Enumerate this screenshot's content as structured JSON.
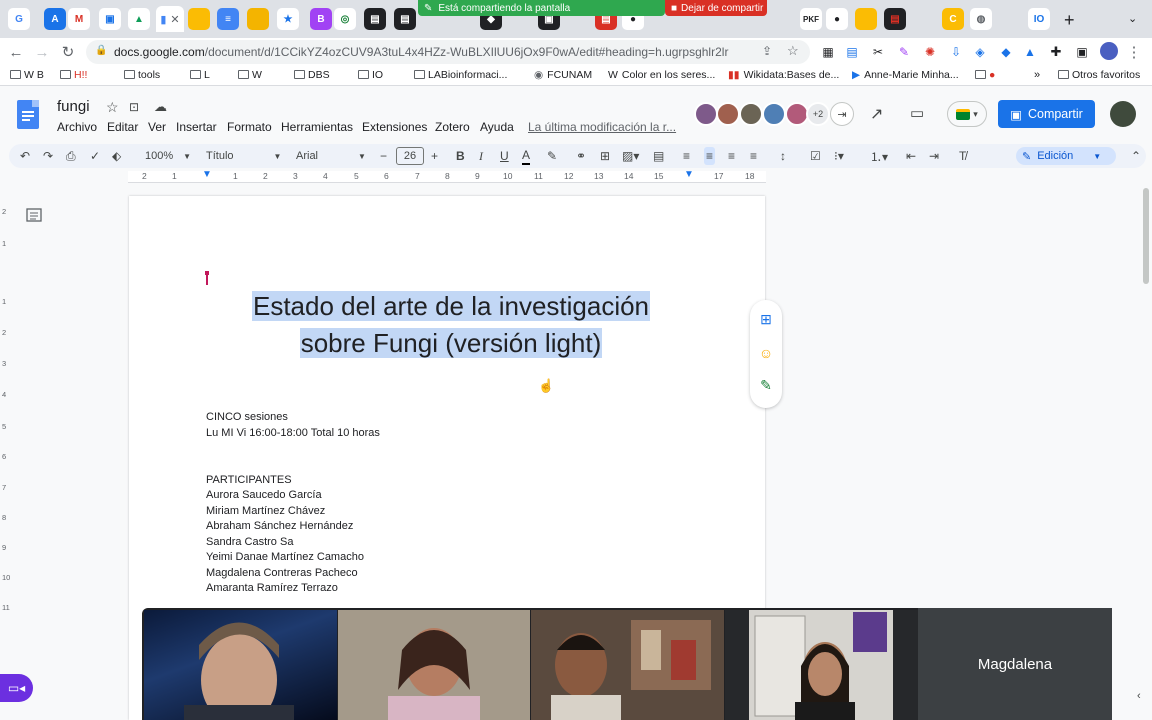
{
  "browser": {
    "sharing_banner": "Está compartiendo la pantalla",
    "stop_sharing": "Dejar de compartir",
    "url_domain": "docs.google.com",
    "url_path": "/document/d/1CCikYZ4ozCUV9A3tuL4x4HZz-WuBLXIlUU6jOx9F0wA/edit#heading=h.ugrpsghlr2lr",
    "new_tab": "+"
  },
  "bookmarks": [
    {
      "label": "W B"
    },
    {
      "label": "H!!"
    },
    {
      "label": "tools"
    },
    {
      "label": "L"
    },
    {
      "label": "W"
    },
    {
      "label": "DBS"
    },
    {
      "label": "IO"
    },
    {
      "label": "LABioinformaci..."
    },
    {
      "label": "FCUNAM"
    },
    {
      "label": "Color en los seres..."
    },
    {
      "label": "Wikidata:Bases de..."
    },
    {
      "label": "Anne-Marie Minha..."
    },
    {
      "label": "»"
    },
    {
      "label": "Otros favoritos"
    }
  ],
  "docs": {
    "title": "fungi",
    "menus": [
      "Archivo",
      "Editar",
      "Ver",
      "Insertar",
      "Formato",
      "Herramientas",
      "Extensiones",
      "Zotero",
      "Ayuda"
    ],
    "last_modified": "La última modificación la r...",
    "extra_viewers": "+2",
    "share_label": "Compartir"
  },
  "toolbar": {
    "zoom": "100%",
    "style": "Título",
    "font": "Arial",
    "font_size": "26",
    "mode": "Edición"
  },
  "ruler": [
    "2",
    "1",
    "1",
    "2",
    "3",
    "4",
    "5",
    "6",
    "7",
    "8",
    "9",
    "10",
    "11",
    "12",
    "13",
    "14",
    "15",
    "16",
    "17",
    "18"
  ],
  "vruler": [
    "2",
    "1",
    "1",
    "2",
    "3",
    "4",
    "5",
    "6",
    "7",
    "8",
    "9",
    "10",
    "11"
  ],
  "document": {
    "title_line1": "Estado del arte de la investigación",
    "title_line2": "sobre Fungi (versión light)",
    "sessions": "CINCO sesiones",
    "schedule": "Lu MI Vi 16:00-18:00 Total 10 horas",
    "participants_heading": "PARTICIPANTES",
    "participants": [
      "Aurora Saucedo García",
      "Miriam Martínez Chávez",
      "Abraham Sánchez Hernández",
      "Sandra Castro Sa",
      "Yeimi Danae Martínez Camacho",
      "Magdalena Contreras Pacheco",
      "Amaranta Ramírez Terrazo"
    ]
  },
  "meet": {
    "speaker_tile_name": "Magdalena"
  },
  "colors": {
    "accent": "#1a73e8",
    "selection": "#c2d7f5",
    "share_banner": "#2fa84f",
    "stop_share": "#d93025"
  }
}
